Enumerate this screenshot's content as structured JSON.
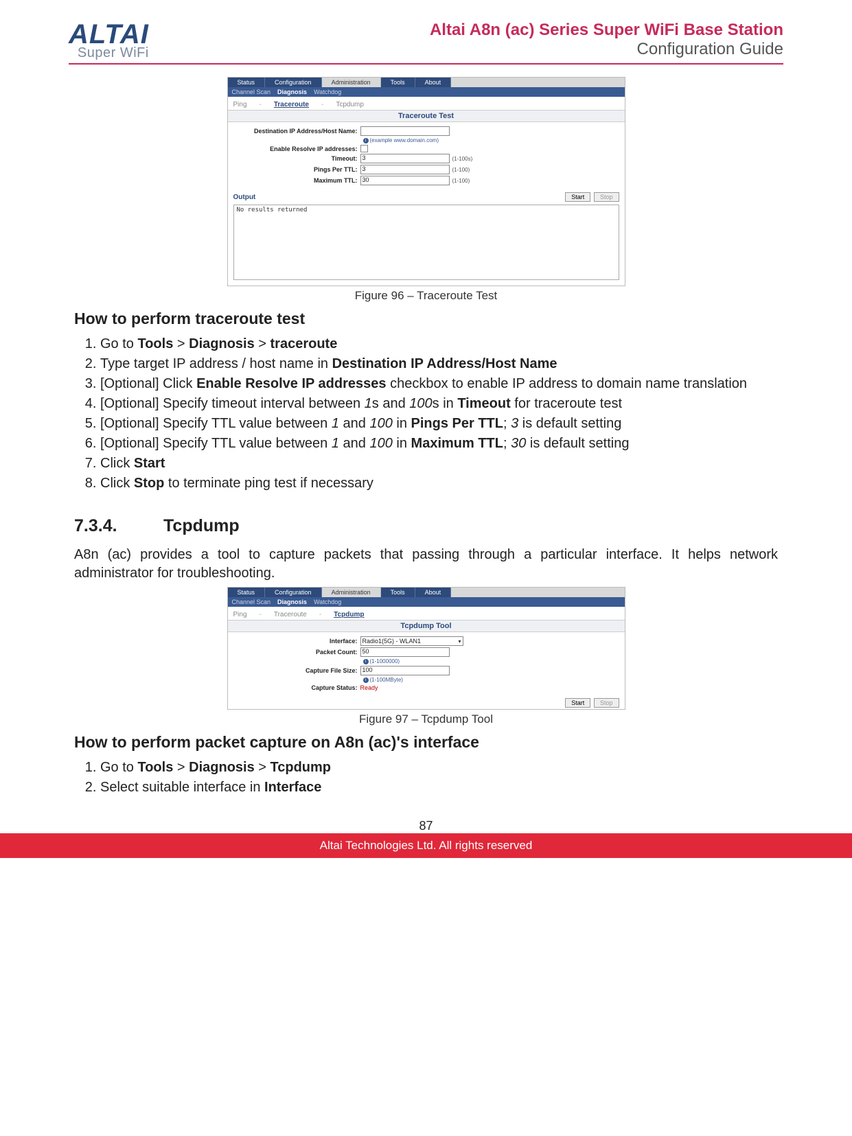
{
  "header": {
    "logo_main": "ALTAI",
    "logo_sub": "Super WiFi",
    "title_line1": "Altai A8n (ac) Series Super WiFi Base Station",
    "title_line2": "Configuration Guide"
  },
  "fig1": {
    "caption": "Figure 96 – Traceroute Test",
    "tabs_main": [
      "Status",
      "Configuration",
      "Administration",
      "Tools",
      "About"
    ],
    "tabs_sub": [
      "Channel Scan",
      "Diagnosis",
      "Watchdog"
    ],
    "tabs_sub_active": "Diagnosis",
    "crumbs": [
      "Ping",
      "Traceroute",
      "Tcpdump"
    ],
    "crumbs_active": "Traceroute",
    "section_title": "Traceroute Test",
    "labels": {
      "dest": "Destination IP Address/Host Name:",
      "dest_hint": "(example www.domain.com)",
      "resolve": "Enable Resolve IP addresses:",
      "timeout": "Timeout:",
      "timeout_range": "(1-100s)",
      "pings": "Pings Per TTL:",
      "pings_range": "(1-100)",
      "maxttl": "Maximum TTL:",
      "maxttl_range": "(1-100)"
    },
    "values": {
      "timeout": "3",
      "pings": "3",
      "maxttl": "30"
    },
    "output_label": "Output",
    "start": "Start",
    "stop": "Stop",
    "output_text": "No results returned"
  },
  "howto1": {
    "title": "How to perform traceroute test",
    "s1_a": "Go to ",
    "s1_b": "Tools",
    "s1_c": " > ",
    "s1_d": "Diagnosis",
    "s1_e": " > ",
    "s1_f": "traceroute",
    "s2_a": "Type target IP address / host name in ",
    "s2_b": "Destination IP Address/Host Name",
    "s3_a": "[Optional] Click ",
    "s3_b": "Enable Resolve IP addresses",
    "s3_c": " checkbox to enable IP address to domain name translation",
    "s4_a": "[Optional] Specify timeout interval between ",
    "s4_b": "1",
    "s4_c": "s and ",
    "s4_d": "100",
    "s4_e": "s in ",
    "s4_f": "Timeout",
    "s4_g": " for traceroute test",
    "s5_a": "[Optional] Specify TTL value between ",
    "s5_b": "1",
    "s5_c": " and ",
    "s5_d": "100",
    "s5_e": " in ",
    "s5_f": "Pings Per TTL",
    "s5_g": "; ",
    "s5_h": "3",
    "s5_i": " is default setting",
    "s6_a": "[Optional] Specify TTL value between ",
    "s6_b": "1",
    "s6_c": " and ",
    "s6_d": "100",
    "s6_e": " in ",
    "s6_f": "Maximum TTL",
    "s6_g": "; ",
    "s6_h": "30",
    "s6_i": " is default setting",
    "s7_a": "Click ",
    "s7_b": "Start",
    "s8_a": "Click ",
    "s8_b": "Stop",
    "s8_c": " to terminate ping test if necessary"
  },
  "section": {
    "num": "7.3.4.",
    "title": "Tcpdump",
    "para": "A8n (ac) provides a tool to capture packets that passing through a particular interface. It helps network administrator for troubleshooting."
  },
  "fig2": {
    "caption": "Figure 97 – Tcpdump Tool",
    "crumbs_active": "Tcpdump",
    "section_title": "Tcpdump Tool",
    "labels": {
      "iface": "Interface:",
      "count": "Packet Count:",
      "count_hint": "(1-1000000)",
      "fsize": "Capture File Size:",
      "fsize_hint": "(1-100MByte)",
      "status": "Capture Status:"
    },
    "values": {
      "iface": "Radio1(5G) - WLAN1",
      "count": "50",
      "fsize": "100",
      "status": "Ready"
    },
    "start": "Start",
    "stop": "Stop"
  },
  "howto2": {
    "title": "How to perform packet capture on A8n (ac)'s interface",
    "s1_a": "Go to ",
    "s1_b": "Tools",
    "s1_c": " > ",
    "s1_d": "Diagnosis",
    "s1_e": " > ",
    "s1_f": "Tcpdump",
    "s2_a": "Select suitable interface in ",
    "s2_b": "Interface"
  },
  "page_number": "87",
  "footer": "Altai Technologies Ltd. All rights reserved"
}
